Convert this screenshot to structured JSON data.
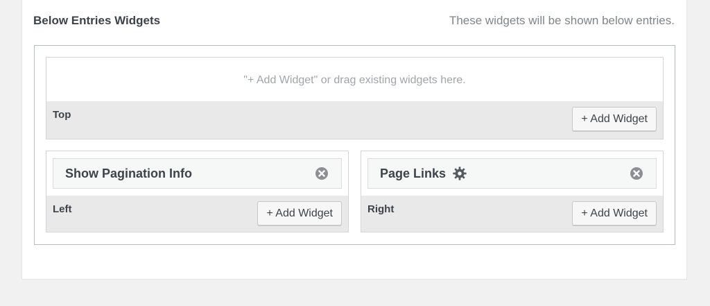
{
  "section": {
    "title": "Below Entries Widgets",
    "description": "These widgets will be shown below entries."
  },
  "areas": {
    "top": {
      "hint": "\"+ Add Widget\" or drag existing widgets here.",
      "label": "Top",
      "add_label": "+ Add Widget"
    },
    "left": {
      "label": "Left",
      "add_label": "+ Add Widget",
      "widgets": [
        {
          "title": "Show Pagination Info",
          "remove_icon": "close-circle-icon"
        }
      ]
    },
    "right": {
      "label": "Right",
      "add_label": "+ Add Widget",
      "widgets": [
        {
          "title": "Page Links",
          "settings_icon": "gear-icon",
          "remove_icon": "close-circle-icon"
        }
      ]
    }
  },
  "colors": {
    "footer_bg": "#e9e9e9",
    "hint_text": "#a0a5aa",
    "icon_gray": "#8c8f94"
  }
}
